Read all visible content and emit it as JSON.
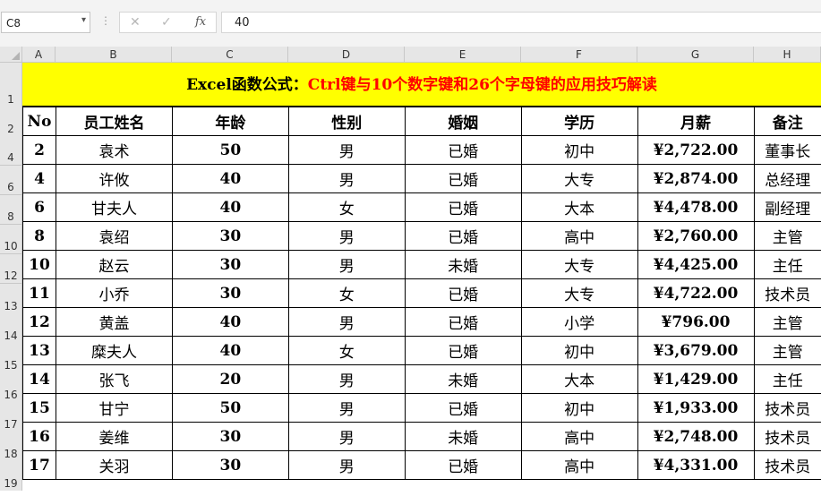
{
  "formula_bar": {
    "name_box": "C8",
    "dots": "⋮",
    "cancel_glyph": "✕",
    "enter_glyph": "✓",
    "fx_glyph": "fx",
    "value": "40"
  },
  "columns": [
    "A",
    "B",
    "C",
    "D",
    "E",
    "F",
    "G",
    "H"
  ],
  "row_headers": [
    {
      "label": "1",
      "separator": false
    },
    {
      "label": "2",
      "separator": false
    },
    {
      "label": "4",
      "separator": true
    },
    {
      "label": "6",
      "separator": true
    },
    {
      "label": "8",
      "separator": true
    },
    {
      "label": "10",
      "separator": true
    },
    {
      "label": "12",
      "separator": true
    },
    {
      "label": "13",
      "separator": false
    },
    {
      "label": "14",
      "separator": false
    },
    {
      "label": "15",
      "separator": false
    },
    {
      "label": "16",
      "separator": false
    },
    {
      "label": "17",
      "separator": false
    },
    {
      "label": "18",
      "separator": false
    },
    {
      "label": "19",
      "separator": false
    }
  ],
  "title": {
    "part1": "Excel函数公式：",
    "part2": "Ctrl键与10个数字键和26个字母键的应用技巧解读"
  },
  "headers": [
    "No",
    "员工姓名",
    "年龄",
    "性别",
    "婚姻",
    "学历",
    "月薪",
    "备注"
  ],
  "rows": [
    [
      "2",
      "袁术",
      "50",
      "男",
      "已婚",
      "初中",
      "¥2,722.00",
      "董事长"
    ],
    [
      "4",
      "许攸",
      "40",
      "男",
      "已婚",
      "大专",
      "¥2,874.00",
      "总经理"
    ],
    [
      "6",
      "甘夫人",
      "40",
      "女",
      "已婚",
      "大本",
      "¥4,478.00",
      "副经理"
    ],
    [
      "8",
      "袁绍",
      "30",
      "男",
      "已婚",
      "高中",
      "¥2,760.00",
      "主管"
    ],
    [
      "10",
      "赵云",
      "30",
      "男",
      "未婚",
      "大专",
      "¥4,425.00",
      "主任"
    ],
    [
      "11",
      "小乔",
      "30",
      "女",
      "已婚",
      "大专",
      "¥4,722.00",
      "技术员"
    ],
    [
      "12",
      "黄盖",
      "40",
      "男",
      "已婚",
      "小学",
      "¥796.00",
      "主管"
    ],
    [
      "13",
      "糜夫人",
      "40",
      "女",
      "已婚",
      "初中",
      "¥3,679.00",
      "主管"
    ],
    [
      "14",
      "张飞",
      "20",
      "男",
      "未婚",
      "大本",
      "¥1,429.00",
      "主任"
    ],
    [
      "15",
      "甘宁",
      "50",
      "男",
      "已婚",
      "初中",
      "¥1,933.00",
      "技术员"
    ],
    [
      "16",
      "姜维",
      "30",
      "男",
      "未婚",
      "高中",
      "¥2,748.00",
      "技术员"
    ],
    [
      "17",
      "关羽",
      "30",
      "男",
      "已婚",
      "高中",
      "¥4,331.00",
      "技术员"
    ]
  ]
}
